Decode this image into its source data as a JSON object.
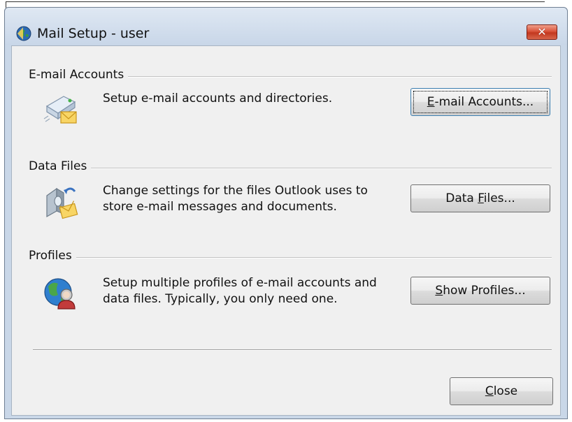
{
  "window": {
    "title": "Mail Setup - user",
    "close_glyph": "✕"
  },
  "sections": {
    "email": {
      "heading": "E-mail Accounts",
      "description": "Setup e-mail accounts and directories.",
      "button_prefix": "",
      "button_mnemonic": "E",
      "button_rest": "-mail Accounts..."
    },
    "datafiles": {
      "heading": "Data Files",
      "description_line1": "Change settings for the files Outlook uses to",
      "description_line2": "store e-mail messages and documents.",
      "button_prefix": "Data ",
      "button_mnemonic": "F",
      "button_rest": "iles..."
    },
    "profiles": {
      "heading": "Profiles",
      "description_line1": "Setup multiple profiles of e-mail accounts and",
      "description_line2": "data files. Typically, you only need one.",
      "button_prefix": "",
      "button_mnemonic": "S",
      "button_rest": "how Profiles..."
    }
  },
  "footer": {
    "close_mnemonic": "C",
    "close_rest": "lose"
  },
  "colors": {
    "client_bg": "#f0f0f0",
    "frame_bg": "#c9d7e8",
    "close_red": "#c2371f"
  },
  "icons": {
    "app": "outlook-globe-icon",
    "email": "email-accounts-icon",
    "datafiles": "data-files-icon",
    "profiles": "profiles-globe-icon"
  }
}
